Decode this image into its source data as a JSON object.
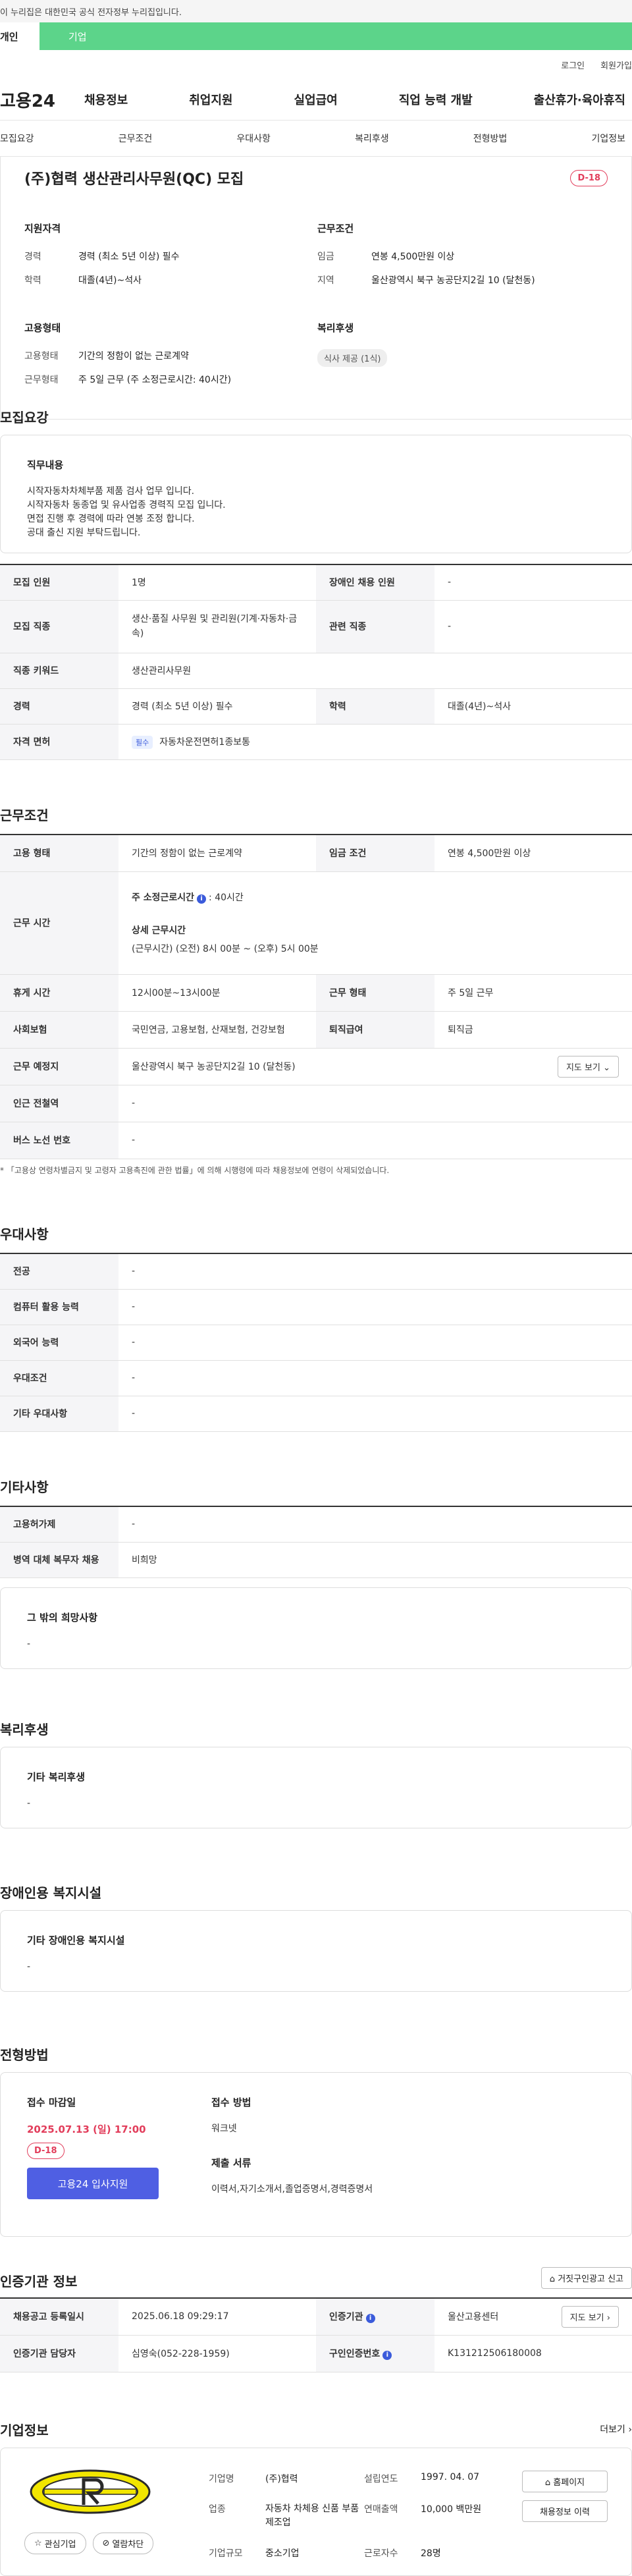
{
  "gov_banner": "이 누리집은 대한민국 공식 전자정부 누리집입니다.",
  "user_tabs": {
    "individual": "개인",
    "corporate": "기업"
  },
  "util_links": [
    "로그인",
    "회원가입"
  ],
  "logo": "고용24",
  "gnb": [
    "채용정보",
    "취업지원",
    "실업급여",
    "직업 능력 개발",
    "출산휴가·육아휴직"
  ],
  "subnav": [
    "모집요강",
    "근무조건",
    "우대사항",
    "복리후생",
    "전형방법",
    "기업정보"
  ],
  "summary": {
    "title": "(주)협력 생산관리사무원(QC) 모집",
    "dday": "D-18",
    "qual": {
      "title": "지원자격",
      "rows": [
        {
          "k": "경력",
          "v": "경력 (최소 5년 이상) 필수"
        },
        {
          "k": "학력",
          "v": "대졸(4년)~석사"
        }
      ]
    },
    "work": {
      "title": "근무조건",
      "rows": [
        {
          "k": "임금",
          "v": "연봉 4,500만원 이상"
        },
        {
          "k": "지역",
          "v": "울산광역시 북구 농공단지2길 10 (달천동)"
        }
      ]
    },
    "emp": {
      "title": "고용형태",
      "rows": [
        {
          "k": "고용형태",
          "v": "기간의 정함이 없는 근로계약"
        },
        {
          "k": "근무형태",
          "v": "주 5일 근무 (주 소정근로시간: 40시간)"
        }
      ]
    },
    "welfare": {
      "title": "복리후생",
      "chip": "식사 제공 (1식)"
    }
  },
  "recruit": {
    "section": "모집요강",
    "duty_title": "직무내용",
    "duty_text": "시작자동차차체부품 제품 검사 업무 입니다.\n시작자동차 동종업 및 유사업종 경력직 모집 입니다.\n면접 진행 후 경력에 따라 연봉 조정 합니다.\n공대 출신 지원 부탁드립니다.",
    "rows": [
      {
        "k1": "모집 인원",
        "v1": "1명",
        "k2": "장애인 채용 인원",
        "v2": "-"
      },
      {
        "k1": "모집 직종",
        "v1": "생산·품질 사무원 및 관리원(기계·자동차·금속)",
        "k2": "관련 직종",
        "v2": "-"
      },
      {
        "k1": "직종 키워드",
        "v1": "생산관리사무원"
      },
      {
        "k1": "경력",
        "v1": "경력 (최소 5년 이상) 필수",
        "k2": "학력",
        "v2": "대졸(4년)~석사"
      },
      {
        "k1": "자격 면허",
        "chip": "필수",
        "v1": "자동차운전면허1종보통"
      }
    ]
  },
  "work_cond": {
    "section": "근무조건",
    "emp_type_k": "고용 형태",
    "emp_type_v": "기간의 정함이 없는 근로계약",
    "wage_k": "임금 조건",
    "wage_v": "연봉 4,500만원 이상",
    "hours_k": "근무 시간",
    "hours_weekly_label": "주 소정근로시간",
    "hours_weekly_value": ": 40시간",
    "hours_detail_label": "상세 근무시간",
    "hours_detail_value": "(근무시간) (오전) 8시 00분 ~ (오후) 5시 00분",
    "break_k": "휴게 시간",
    "break_v": "12시00분~13시00분",
    "shift_k": "근무 형태",
    "shift_v": "주 5일 근무",
    "ins_k": "사회보험",
    "ins_v": "국민연금, 고용보험, 산재보험, 건강보험",
    "sev_k": "퇴직급여",
    "sev_v": "퇴직금",
    "loc_k": "근무 예정지",
    "loc_v": "울산광역시 북구 농공단지2길 10 (달천동)",
    "map_btn": "지도 보기",
    "subway_k": "인근 전철역",
    "subway_v": "-",
    "bus_k": "버스 노선 번호",
    "bus_v": "-",
    "notice": "* 「고용상 연령차별금지 및 고령자 고용촉진에 관한 법률」에 의해 시행령에 따라 채용정보에 연령이 삭제되었습니다."
  },
  "pref": {
    "section": "우대사항",
    "rows": [
      {
        "k": "전공",
        "v": "-"
      },
      {
        "k": "컴퓨터 활용 능력",
        "v": "-"
      },
      {
        "k": "외국어 능력",
        "v": "-"
      },
      {
        "k": "우대조건",
        "v": "-"
      },
      {
        "k": "기타 우대사항",
        "v": "-"
      }
    ]
  },
  "etc": {
    "section": "기타사항",
    "rows": [
      {
        "k": "고용허가제",
        "v": "-"
      },
      {
        "k": "병역 대체 복무자 채용",
        "v": "비희망"
      }
    ],
    "box_title": "그 밖의 희망사항",
    "box_text": "-"
  },
  "welfare": {
    "section": "복리후생",
    "box_title": "기타 복리후생",
    "box_text": "-"
  },
  "disabled": {
    "section": "장애인용 복지시설",
    "box_title": "기타 장애인용 복지시설",
    "box_text": "-"
  },
  "selection": {
    "section": "전형방법",
    "deadline_label": "접수 마감일",
    "deadline": "2025.07.13 (일) 17:00",
    "dday": "D-18",
    "apply_btn": "고용24 입사지원",
    "method_label": "접수 방법",
    "method": "워크넷",
    "docs_label": "제출 서류",
    "docs": "이력서,자기소개서,졸업증명서,경력증명서"
  },
  "cert": {
    "section": "인증기관 정보",
    "report_btn": "거짓구인광고 신고",
    "reg_k": "채용공고 등록일시",
    "reg_v": "2025.06.18 09:29:17",
    "org_k": "인증기관",
    "org_v": "울산고용센터",
    "map_btn": "지도 보기",
    "mgr_k": "인증기관 담당자",
    "mgr_v": "심영숙(052-228-1959)",
    "num_k": "구인인증번호",
    "num_v": "K131212506180008"
  },
  "company": {
    "section": "기업정보",
    "more": "더보기",
    "fav_btn": "관심기업",
    "block_btn": "열람차단",
    "name_k": "기업명",
    "name_v": "(주)협력",
    "since_k": "설립연도",
    "since_v": "1997. 04. 07",
    "biz_k": "업종",
    "biz_v": "자동차 차체용 신품 부품 제조업",
    "sales_k": "연매출액",
    "sales_v": "10,000 백만원",
    "size_k": "기업규모",
    "size_v": "중소기업",
    "staff_k": "근로자수",
    "staff_v": "28명",
    "home_btn": "홈페이지",
    "history_btn": "채용정보 이력"
  },
  "colors": {
    "accent_green": "#5cd48a",
    "accent_blue": "#4f5fe3",
    "dday_red": "#e23d5b"
  }
}
